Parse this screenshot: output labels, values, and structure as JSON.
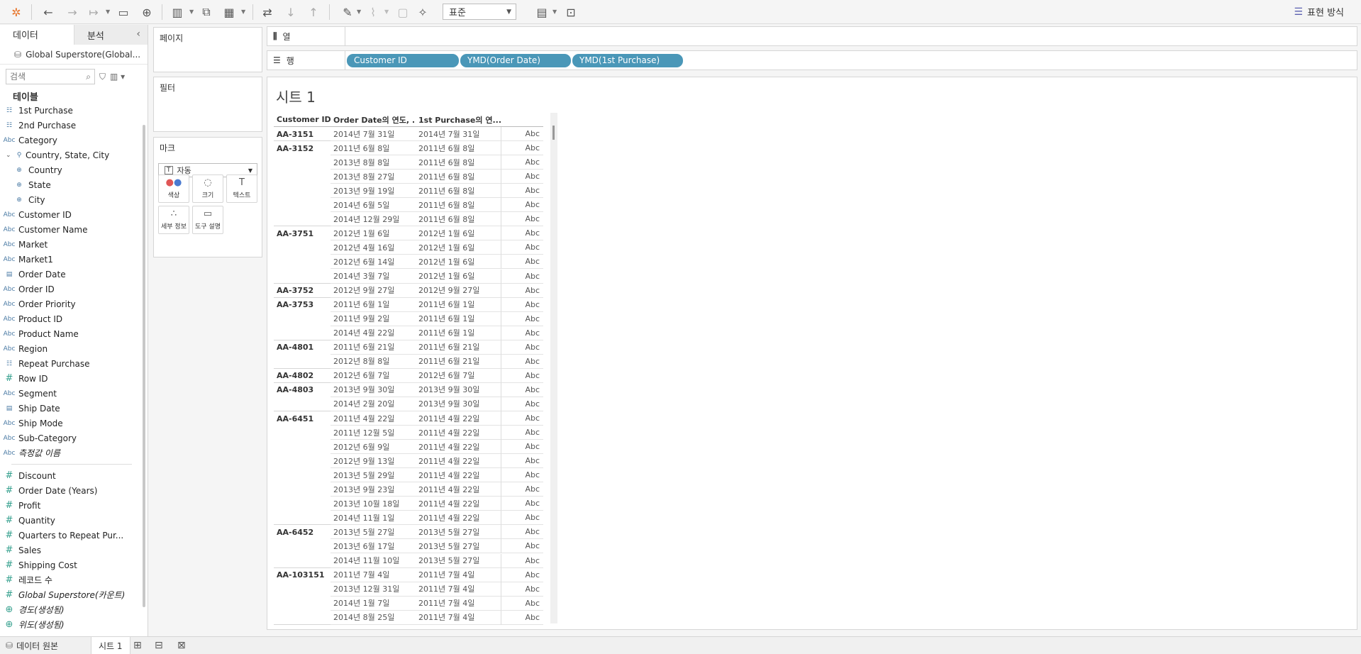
{
  "toolbar": {
    "fit_select": "표준",
    "show_me": "표현 방식"
  },
  "left": {
    "tabs": [
      "데이터",
      "분석"
    ],
    "datasource": "Global Superstore(Global...",
    "search_placeholder": "검색",
    "tables_heading": "테이블",
    "dimensions": [
      {
        "icon": "table",
        "label": "1st Purchase"
      },
      {
        "icon": "table",
        "label": "2nd Purchase"
      },
      {
        "icon": "abc",
        "label": "Category"
      },
      {
        "icon": "hierarchy",
        "label": "Country, State, City",
        "expanded": true
      },
      {
        "icon": "globe",
        "label": "Country",
        "child": true
      },
      {
        "icon": "globe",
        "label": "State",
        "child": true
      },
      {
        "icon": "globe",
        "label": "City",
        "child": true
      },
      {
        "icon": "abc",
        "label": "Customer ID"
      },
      {
        "icon": "abc",
        "label": "Customer Name"
      },
      {
        "icon": "abc",
        "label": "Market"
      },
      {
        "icon": "abc",
        "label": "Market1"
      },
      {
        "icon": "date",
        "label": "Order Date"
      },
      {
        "icon": "abc",
        "label": "Order ID"
      },
      {
        "icon": "abc",
        "label": "Order Priority"
      },
      {
        "icon": "abc",
        "label": "Product ID"
      },
      {
        "icon": "abc",
        "label": "Product Name"
      },
      {
        "icon": "abc",
        "label": "Region"
      },
      {
        "icon": "table",
        "label": "Repeat Purchase"
      },
      {
        "icon": "hash",
        "label": "Row ID"
      },
      {
        "icon": "abc",
        "label": "Segment"
      },
      {
        "icon": "date",
        "label": "Ship Date"
      },
      {
        "icon": "abc",
        "label": "Ship Mode"
      },
      {
        "icon": "abc",
        "label": "Sub-Category"
      },
      {
        "icon": "abc",
        "label": "측정값 이름",
        "italic": true
      }
    ],
    "measures": [
      {
        "icon": "hash",
        "label": "Discount"
      },
      {
        "icon": "hash",
        "label": "Order Date (Years)"
      },
      {
        "icon": "hash",
        "label": "Profit"
      },
      {
        "icon": "hash",
        "label": "Quantity"
      },
      {
        "icon": "hash",
        "label": "Quarters to Repeat Pur..."
      },
      {
        "icon": "hash",
        "label": "Sales"
      },
      {
        "icon": "hash",
        "label": "Shipping Cost"
      },
      {
        "icon": "hash",
        "label": "레코드 수"
      },
      {
        "icon": "hash",
        "label": "Global Superstore(카운트)",
        "italic": true
      },
      {
        "icon": "globe",
        "label": "경도(생성됨)",
        "italic": true
      },
      {
        "icon": "globe",
        "label": "위도(생성됨)",
        "italic": true
      }
    ]
  },
  "cards": {
    "pages": "페이지",
    "filters": "필터",
    "marks": "마크",
    "marks_type": "자동",
    "mark_buttons": [
      "색상",
      "크기",
      "텍스트",
      "세부 정보",
      "도구 설명"
    ]
  },
  "shelves": {
    "columns_label": "열",
    "rows_label": "행",
    "row_pills": [
      "Customer ID",
      "YMD(Order Date)",
      "YMD(1st Purchase)"
    ]
  },
  "sheet": {
    "title": "시트 1",
    "headers": [
      "Customer ID",
      "Order Date의 연도, ...",
      "1st Purchase의 연..."
    ],
    "abc": "Abc",
    "groups": [
      {
        "id": "AA-3151",
        "rows": [
          [
            "2014년 7월 31일",
            "2014년 7월 31일"
          ]
        ]
      },
      {
        "id": "AA-3152",
        "rows": [
          [
            "2011년 6월 8일",
            "2011년 6월 8일"
          ],
          [
            "2013년 8월 8일",
            "2011년 6월 8일"
          ],
          [
            "2013년 8월 27일",
            "2011년 6월 8일"
          ],
          [
            "2013년 9월 19일",
            "2011년 6월 8일"
          ],
          [
            "2014년 6월 5일",
            "2011년 6월 8일"
          ],
          [
            "2014년 12월 29일",
            "2011년 6월 8일"
          ]
        ]
      },
      {
        "id": "AA-3751",
        "rows": [
          [
            "2012년 1월 6일",
            "2012년 1월 6일"
          ],
          [
            "2012년 4월 16일",
            "2012년 1월 6일"
          ],
          [
            "2012년 6월 14일",
            "2012년 1월 6일"
          ],
          [
            "2014년 3월 7일",
            "2012년 1월 6일"
          ]
        ]
      },
      {
        "id": "AA-3752",
        "rows": [
          [
            "2012년 9월 27일",
            "2012년 9월 27일"
          ]
        ]
      },
      {
        "id": "AA-3753",
        "rows": [
          [
            "2011년 6월 1일",
            "2011년 6월 1일"
          ],
          [
            "2011년 9월 2일",
            "2011년 6월 1일"
          ],
          [
            "2014년 4월 22일",
            "2011년 6월 1일"
          ]
        ]
      },
      {
        "id": "AA-4801",
        "rows": [
          [
            "2011년 6월 21일",
            "2011년 6월 21일"
          ],
          [
            "2012년 8월 8일",
            "2011년 6월 21일"
          ]
        ]
      },
      {
        "id": "AA-4802",
        "rows": [
          [
            "2012년 6월 7일",
            "2012년 6월 7일"
          ]
        ]
      },
      {
        "id": "AA-4803",
        "rows": [
          [
            "2013년 9월 30일",
            "2013년 9월 30일"
          ],
          [
            "2014년 2월 20일",
            "2013년 9월 30일"
          ]
        ]
      },
      {
        "id": "AA-6451",
        "rows": [
          [
            "2011년 4월 22일",
            "2011년 4월 22일"
          ],
          [
            "2011년 12월 5일",
            "2011년 4월 22일"
          ],
          [
            "2012년 6월 9일",
            "2011년 4월 22일"
          ],
          [
            "2012년 9월 13일",
            "2011년 4월 22일"
          ],
          [
            "2013년 5월 29일",
            "2011년 4월 22일"
          ],
          [
            "2013년 9월 23일",
            "2011년 4월 22일"
          ],
          [
            "2013년 10월 18일",
            "2011년 4월 22일"
          ],
          [
            "2014년 11월 1일",
            "2011년 4월 22일"
          ]
        ]
      },
      {
        "id": "AA-6452",
        "rows": [
          [
            "2013년 5월 27일",
            "2013년 5월 27일"
          ],
          [
            "2013년 6월 17일",
            "2013년 5월 27일"
          ],
          [
            "2014년 11월 10일",
            "2013년 5월 27일"
          ]
        ]
      },
      {
        "id": "AA-103151",
        "rows": [
          [
            "2011년 7월 4일",
            "2011년 7월 4일"
          ],
          [
            "2013년 12월 31일",
            "2011년 7월 4일"
          ],
          [
            "2014년 1월 7일",
            "2011년 7월 4일"
          ],
          [
            "2014년 8월 25일",
            "2011년 7월 4일"
          ]
        ]
      }
    ]
  },
  "bottom": {
    "datasource_tab": "데이터 원본",
    "sheet_tab": "시트 1"
  }
}
